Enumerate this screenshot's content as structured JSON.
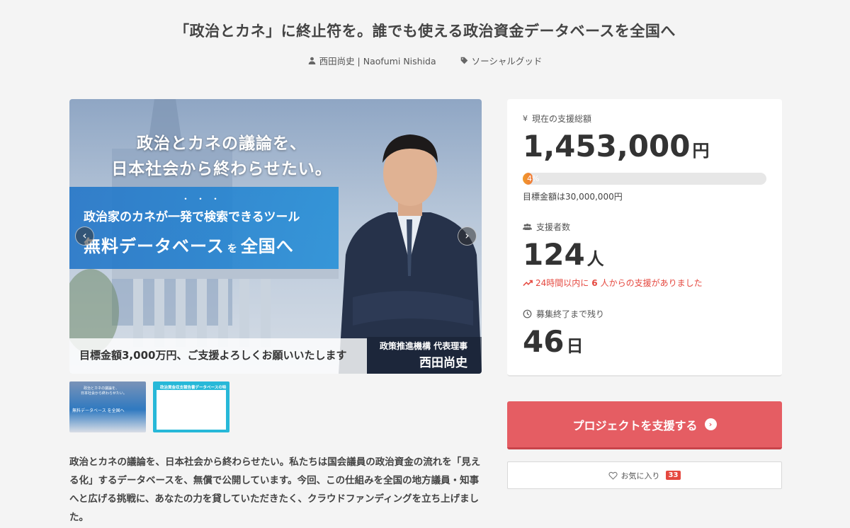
{
  "page": {
    "title": "「政治とカネ」に終止符を。誰でも使える政治資金データベースを全国へ",
    "author": "西田尚史 | Naofumi Nishida",
    "category": "ソーシャルグッド"
  },
  "hero": {
    "line1": "政治とカネの議論を、",
    "line2": "日本社会から終わらせたい。",
    "dots": "・・・",
    "band_line1": "政治家のカネが一発で検索できるツール",
    "band_line2_a": "無料データベース",
    "band_line2_b": "を",
    "band_line2_c": "全国へ",
    "bottom_text": "目標金額3,000万円、ご支援よろしくお願いいたします",
    "caption_role": "政策推進機構 代表理事",
    "caption_name": "西田尚史",
    "prev_icon": "‹",
    "next_icon": "›"
  },
  "thumbnails": {
    "t1_lines": [
      "政治とカネの議論を、",
      "日本社会から終わらせたい。",
      "無料データベース を全国へ"
    ],
    "t2_title": "政治資金収支報告書データベースの特徴"
  },
  "description": "政治とカネの議論を、日本社会から終わらせたい。私たちは国会議員の政治資金の流れを「見える化」するデータベースを、無償で公開しています。今回、この仕組みを全国の地方議員・知事へと広げる挑戦に、あなたの力を貸していただきたく、クラウドファンディングを立ち上げました。",
  "panel": {
    "total_label": "現在の支援総額",
    "total_value": "1,453,000",
    "total_unit": "円",
    "progress_text": "4%",
    "progress_fraction": 0.04,
    "goal_text": "目標金額は30,000,000円",
    "supporters_label": "支援者数",
    "supporters_value": "124",
    "supporters_unit": "人",
    "trend_prefix": "24時間以内に",
    "trend_count": "6",
    "trend_suffix": "人からの支援がありました",
    "remaining_label": "募集終了まで残り",
    "remaining_value": "46",
    "remaining_unit": "日"
  },
  "actions": {
    "support_label": "プロジェクトを支援する",
    "support_icon": "›",
    "favorite_label": "お気に入り",
    "favorite_count": "33"
  },
  "colors": {
    "accent": "#e55d63",
    "progress": "#f0862f",
    "trend": "#e5483f"
  }
}
